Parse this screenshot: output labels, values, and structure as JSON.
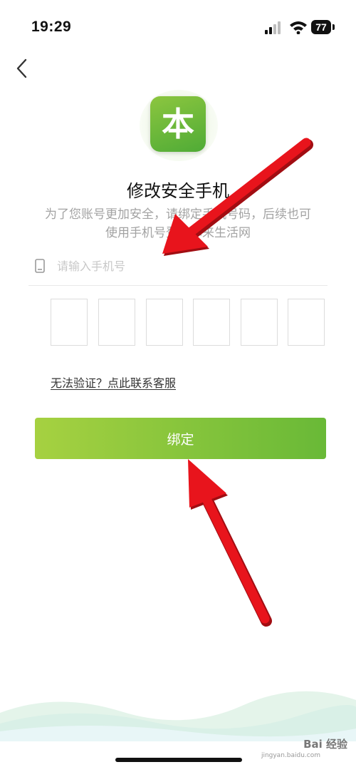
{
  "status_bar": {
    "time": "19:29",
    "battery": "77",
    "icons": [
      "signal-icon",
      "wifi-icon",
      "battery-icon"
    ]
  },
  "nav": {
    "back_icon": "chevron-left-icon"
  },
  "logo": {
    "glyph": "本",
    "color": "#6cbb3c"
  },
  "page": {
    "title": "修改安全手机",
    "description": "为了您账号更加安全，请绑定手机号码，后续也可使用手机号登录本来生活网"
  },
  "phone_field": {
    "placeholder": "请输入手机号",
    "value": "",
    "icon": "phone-icon"
  },
  "verification_code": {
    "length": 6
  },
  "help": {
    "link_text": "无法验证？点此联系客服"
  },
  "primary_action": {
    "label": "绑定"
  },
  "annotations": {
    "arrow_color": "#e8141c"
  },
  "watermark": {
    "text": "Bai 经验",
    "sub": "jingyan.baidu.com"
  },
  "colors": {
    "accent": "#7dc23a",
    "text_primary": "#111111",
    "text_secondary": "#a3a3a3"
  }
}
